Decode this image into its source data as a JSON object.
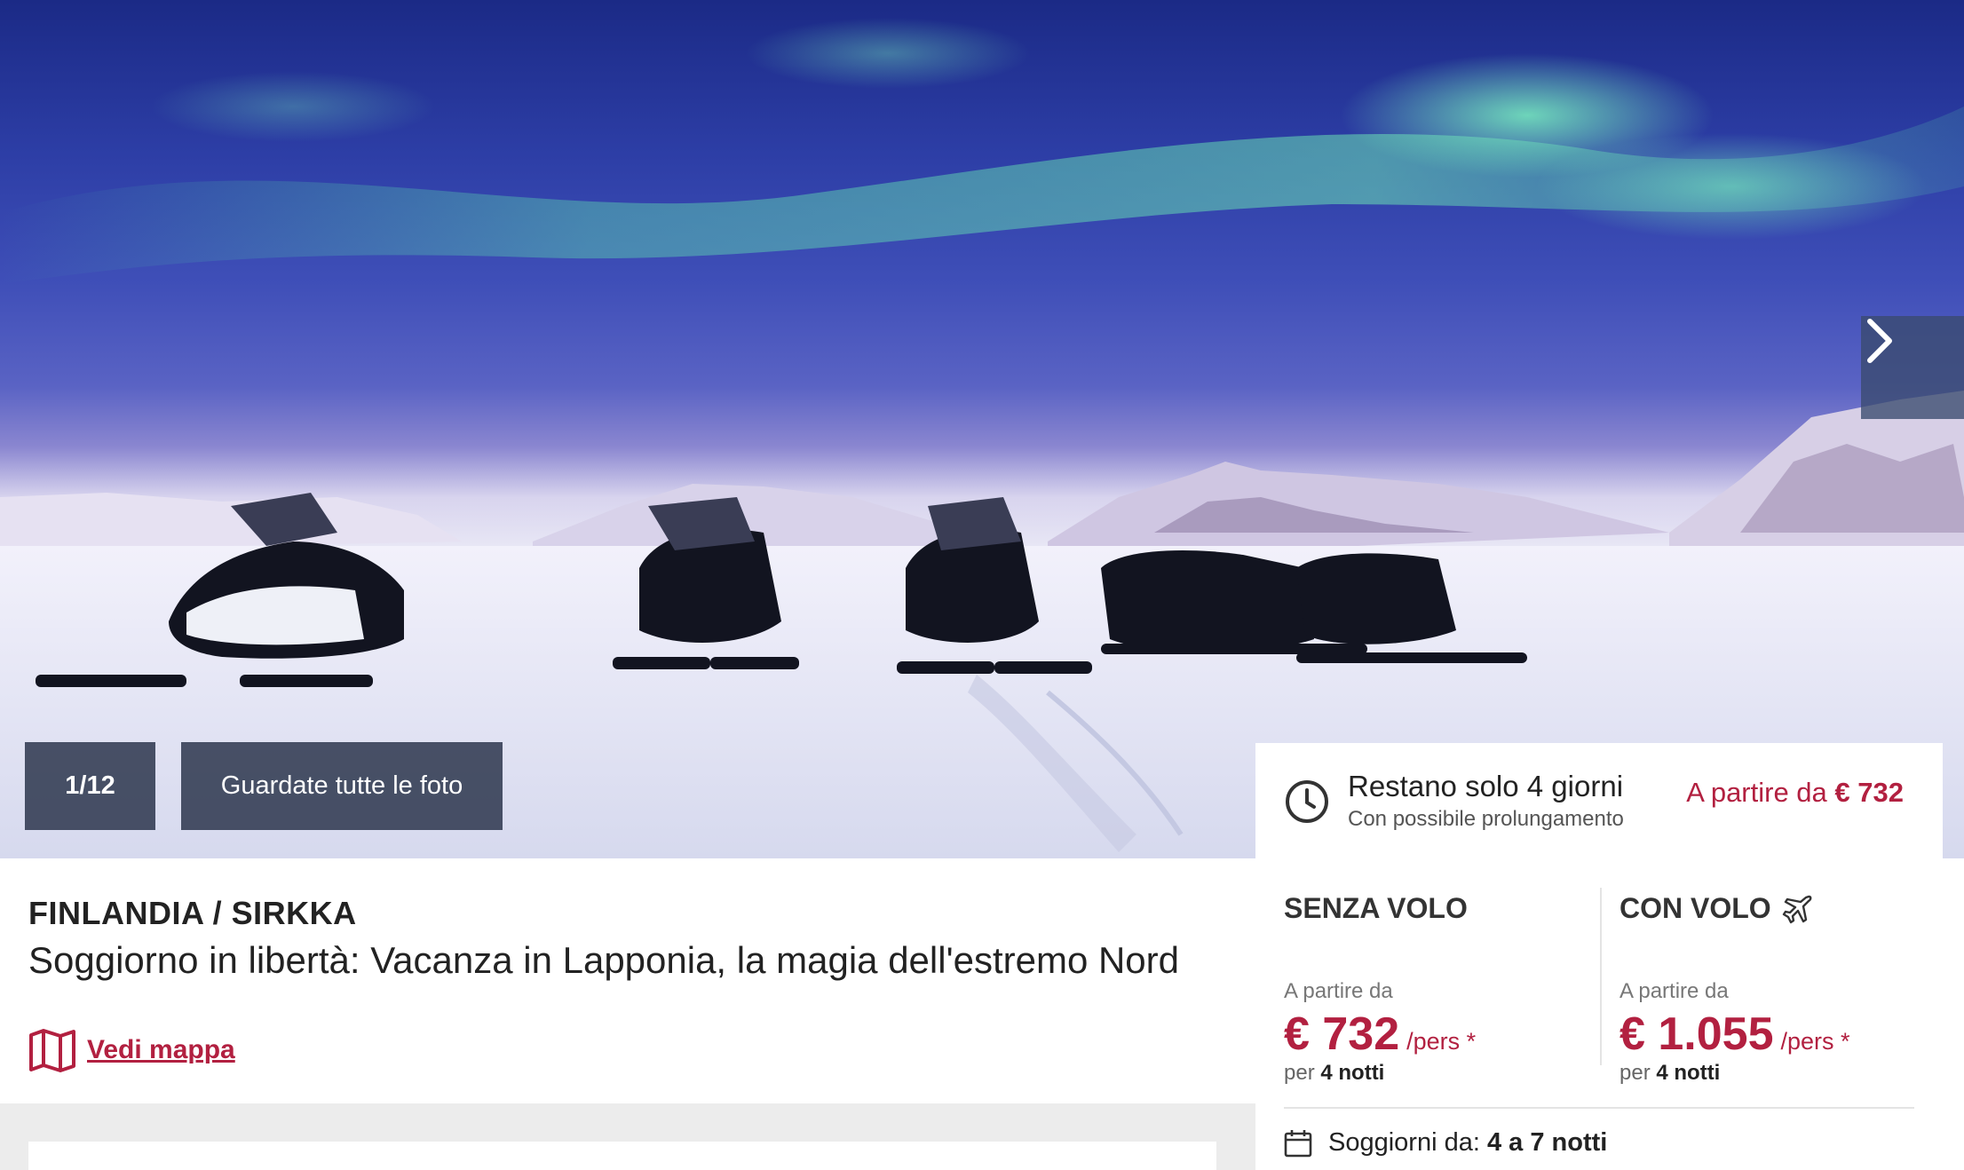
{
  "hero": {
    "photo_counter": "1/12",
    "all_photos_label": "Guardate tutte le foto",
    "next_icon": "chevron-right-icon"
  },
  "destination": {
    "location": "FINLANDIA / SIRKKA",
    "title": "Soggiorno in libertà: Vacanza in Lapponia, la magia dell'estremo Nord",
    "map_link": "Vedi mappa"
  },
  "booking": {
    "countdown_title": "Restano solo 4 giorni",
    "countdown_subtitle": "Con possibile prolungamento",
    "from_label": "A partire da",
    "from_price": "€ 732",
    "without_flight": {
      "title": "SENZA VOLO",
      "from_label": "A partire da",
      "price": "€ 732",
      "per_label": "/pers *",
      "nights_prefix": "per",
      "nights": "4 notti"
    },
    "with_flight": {
      "title": "CON VOLO",
      "from_label": "A partire da",
      "price": "€ 1.055",
      "per_label": "/pers *",
      "nights_prefix": "per",
      "nights": "4 notti"
    },
    "stay_label": "Soggiorni da:",
    "stay_value": "4 a 7 notti"
  },
  "colors": {
    "accent": "#b22040",
    "overlay": "#2d374e"
  }
}
